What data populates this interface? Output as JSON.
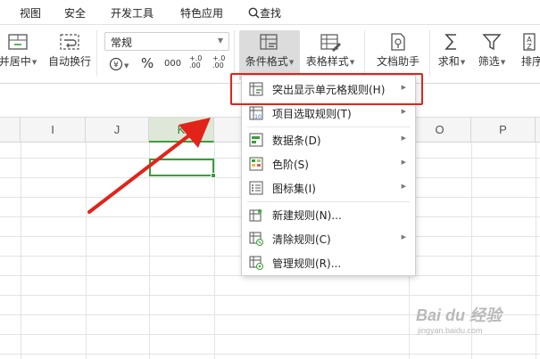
{
  "menubar": {
    "tabs": [
      "视图",
      "安全",
      "开发工具",
      "特色应用"
    ],
    "search_label": "查找"
  },
  "ribbon": {
    "merge_center": "并居中",
    "wrap_text": "自动换行",
    "number_format": "常规",
    "percent_symbol": "%",
    "thousands_symbol": "000",
    "decimal_inc": "+.0 .00",
    "decimal_dec": "+.0 .00",
    "conditional_format": "条件格式",
    "table_style": "表格样式",
    "doc_assistant": "文档助手",
    "sum": "求和",
    "filter": "筛选",
    "sort": "排序"
  },
  "grid": {
    "columns": [
      "I",
      "J",
      "K",
      "",
      "",
      "O",
      "P"
    ],
    "active_column": "K"
  },
  "dropdown": {
    "items": [
      {
        "label": "突出显示单元格规则(H)",
        "has_submenu": true,
        "icon": "highlight-rules-icon"
      },
      {
        "label": "项目选取规则(T)",
        "has_submenu": true,
        "icon": "top-bottom-rules-icon"
      },
      {
        "label": "数据条(D)",
        "has_submenu": true,
        "icon": "data-bars-icon"
      },
      {
        "label": "色阶(S)",
        "has_submenu": true,
        "icon": "color-scales-icon"
      },
      {
        "label": "图标集(I)",
        "has_submenu": true,
        "icon": "icon-sets-icon"
      },
      {
        "label": "新建规则(N)...",
        "has_submenu": false,
        "icon": "new-rule-icon"
      },
      {
        "label": "清除规则(C)",
        "has_submenu": true,
        "icon": "clear-rules-icon"
      },
      {
        "label": "管理规则(R)...",
        "has_submenu": false,
        "icon": "manage-rules-icon"
      }
    ]
  },
  "colors": {
    "accent_green": "#3a9d3a",
    "annotation_red": "#e2231a"
  },
  "watermark": {
    "brand": "Bai du 经验",
    "url": "jingyan.baidu.com"
  }
}
